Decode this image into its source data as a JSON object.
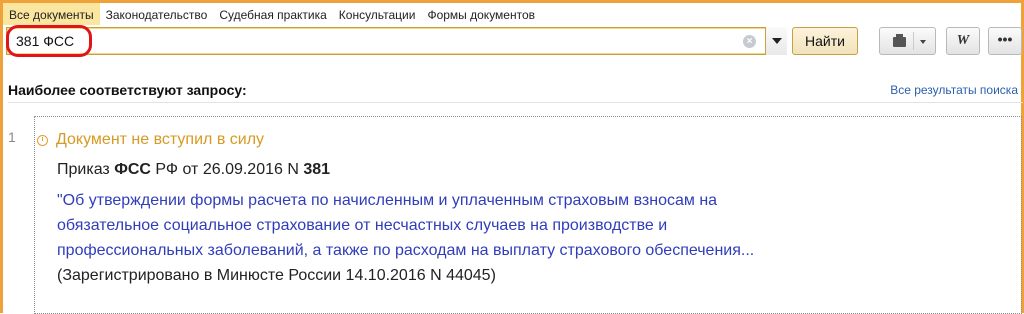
{
  "tabs": [
    "Все документы",
    "Законодательство",
    "Судебная практика",
    "Консультации",
    "Формы документов"
  ],
  "search": {
    "value": "381 ФСС",
    "button": "Найти"
  },
  "toolbar": {
    "print": "print-icon",
    "word_label": "W",
    "more_label": "•••"
  },
  "results_header": {
    "title": "Наиболее соответствуют запросу:",
    "all_link": "Все результаты поиска"
  },
  "result": {
    "number": "1",
    "status": "Документ не вступил в силу",
    "heading_pre": "Приказ ",
    "heading_org": "ФСС",
    "heading_mid": " РФ от 26.09.2016 N ",
    "heading_num": "381",
    "title_lines": [
      "\"Об утверждении формы расчета по начисленным и уплаченным страховым взносам на",
      "обязательное социальное страхование от несчастных случаев на производстве и",
      "профессиональных заболеваний, а также по расходам на выплату страхового обеспечения..."
    ],
    "registration": "(Зарегистрировано в Минюсте России 14.10.2016 N 44045)"
  },
  "colors": {
    "accent": "#f0a23a",
    "highlight": "#e0151a",
    "link": "#2f3dbb",
    "status": "#d79a22"
  }
}
